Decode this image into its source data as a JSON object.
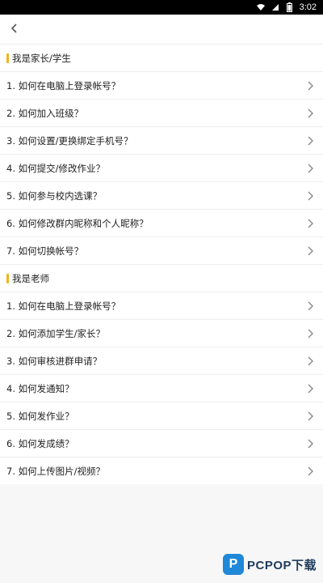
{
  "status_bar": {
    "time": "3:02",
    "icons": [
      "wifi-icon",
      "signal-icon",
      "battery-icon"
    ]
  },
  "header": {
    "back_icon": "chevron-left-icon"
  },
  "sections": [
    {
      "title": "我是家长/学生",
      "items": [
        "1. 如何在电脑上登录帐号？",
        "2. 如何加入班级？",
        "3. 如何设置/更换绑定手机号？",
        "4. 如何提交/修改作业？",
        "5. 如何参与校内选课？",
        "6. 如何修改群内昵称和个人昵称？",
        "7. 如何切换帐号？"
      ]
    },
    {
      "title": "我是老师",
      "items": [
        "1. 如何在电脑上登录帐号？",
        "2. 如何添加学生/家长？",
        "3. 如何审核进群申请？",
        "4. 如何发通知？",
        "5. 如何发作业？",
        "6. 如何发成绩？",
        "7. 如何上传图片/视频？"
      ]
    }
  ],
  "watermark": {
    "text": "PCPOP下载"
  },
  "colors": {
    "accent": "#f1b51a",
    "background": "#f7f7f7",
    "row_background": "#ffffff",
    "divider": "#eeeeee",
    "text": "#222222",
    "chevron": "#888888"
  }
}
